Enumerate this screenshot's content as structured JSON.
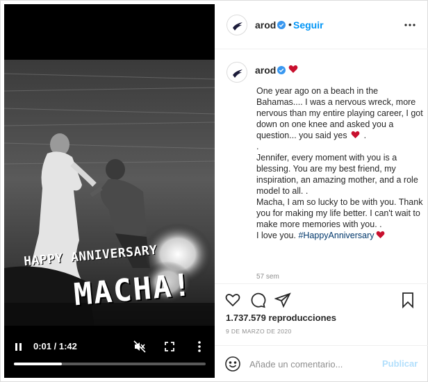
{
  "video": {
    "overlay_line1": "HAPPY ANNIVERSARY",
    "overlay_line2": "MACHA!",
    "time_display": "0:01 / 1:42",
    "progress_fraction": 0.25
  },
  "header": {
    "username": "arod",
    "separator": "•",
    "follow_label": "Seguir"
  },
  "caption": {
    "username": "arod",
    "text_part1": "One year ago on a beach in the Bahamas.... I was a nervous wreck, more nervous than my entire playing career, I got down on one knee and asked you a question... you said yes ",
    "text_part2": " .\n.\nJennifer, every moment with you is a blessing. You are my best friend, my inspiration, an amazing mother, and a role model to all. .\nMacha, I am so lucky to be with you. Thank you for making my life better. I can't wait to make more memories with you. .\nI love you. ",
    "hashtag": "#HappyAnniversary",
    "age": "57 sem"
  },
  "stats": {
    "views": "1.737.579 reproducciones",
    "date": "9 DE MARZO DE 2020"
  },
  "comment": {
    "placeholder": "Añade un comentario...",
    "publish_label": "Publicar"
  },
  "colors": {
    "accent": "#0095f6",
    "heart": "#ed4956",
    "verified": "#3897f0",
    "hashtag": "#00376b"
  },
  "icons": [
    "play-pause-icon",
    "mute-icon",
    "fullscreen-icon",
    "more-vertical-icon",
    "more-horizontal-icon",
    "verified-badge-icon",
    "heart-emoji-icon",
    "like-icon",
    "comment-icon",
    "share-icon",
    "save-icon",
    "emoji-icon"
  ]
}
